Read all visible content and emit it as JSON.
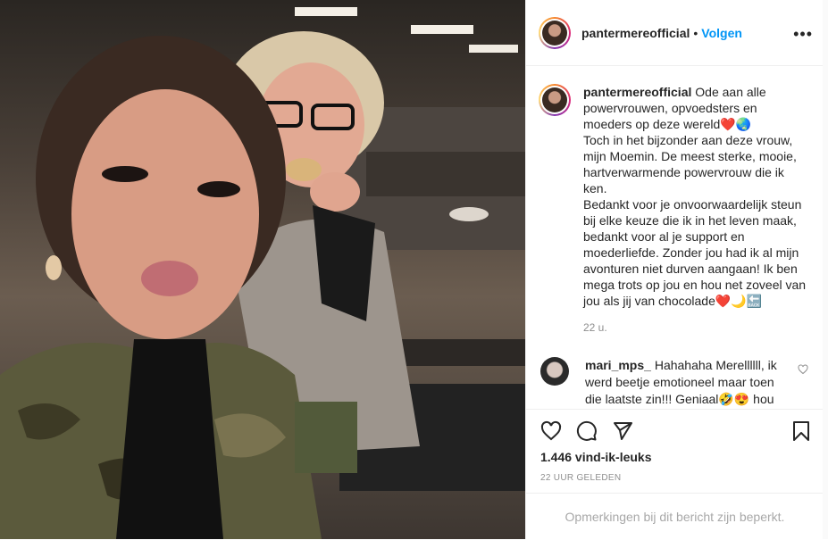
{
  "post": {
    "username": "pantermereofficial",
    "follow_label": "Volgen",
    "dot": "•",
    "more_label": "•••"
  },
  "caption": {
    "username": "pantermereofficial",
    "lines": [
      "Ode aan alle powervrouwen, opvoedsters en moeders op deze wereld❤️🌏",
      "Toch in het bijzonder aan deze vrouw, mijn Moemin. De meest sterke, mooie, hartverwarmende powervrouw die ik ken.",
      "Bedankt voor je onvoorwaardelijk steun bij elke keuze die ik in het leven maak, bedankt voor al je support en moederliefde. Zonder jou had ik al mijn avonturen niet durven aangaan! Ik ben mega trots op jou en hou net zoveel van jou als jij van chocolade❤️🌙🔙"
    ],
    "time": "22 u."
  },
  "comment": {
    "username": "mari_mps_",
    "text": "Hahahaha Merellllll, ik werd beetje emotioneel maar toen die laatste zin!!! Geniaal🤣😍 hou"
  },
  "actions": {
    "likes": "1.446 vind-ik-leuks",
    "time": "22 UUR GELEDEN",
    "limited_notice": "Opmerkingen bij dit bericht zijn beperkt."
  }
}
